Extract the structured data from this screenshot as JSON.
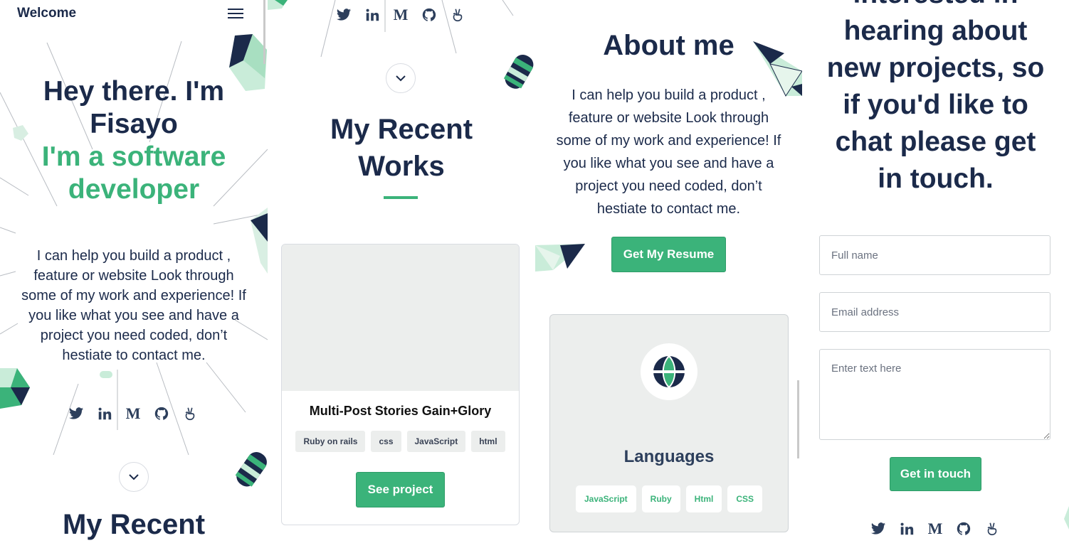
{
  "colors": {
    "navy": "#1b2a4a",
    "green": "#3bb37a",
    "grey_bg": "#eceeed"
  },
  "panel1": {
    "header_title": "Welcome",
    "menu_icon": "hamburger-icon",
    "hero_line1": "Hey there. I'm",
    "hero_line2": "Fisayo",
    "hero_sub_line1": "I'm a software",
    "hero_sub_line2": "developer",
    "intro": "I can help you build a product , feature or website Look through some of my work and experience! If you like what you see and have a project you need coded, don’t hestiate to contact me.",
    "section_peek": "My Recent"
  },
  "socials": {
    "twitter": "twitter-icon",
    "linkedin": "in",
    "medium": "M",
    "github": "github-icon",
    "angellist": "angellist-icon"
  },
  "panel2": {
    "section_title_line1": "My Recent",
    "section_title_line2": "Works",
    "project": {
      "title": "Multi-Post Stories Gain+Glory",
      "tags": [
        "Ruby on rails",
        "css",
        "JavaScript",
        "html"
      ],
      "button": "See project"
    }
  },
  "panel3": {
    "title": "About me",
    "intro": "I can help you build a product , feature or website Look through some of my work and experience! If you like what you see and have a project you need coded, don’t hestiate to contact me.",
    "resume_button": "Get My Resume",
    "skills": {
      "icon": "globe-icon",
      "title": "Languages",
      "tags": [
        "JavaScript",
        "Ruby",
        "Html",
        "CSS"
      ]
    }
  },
  "panel4": {
    "title_lines": [
      "interested in",
      "hearing about",
      "new projects, so",
      "if you'd like to",
      "chat please get",
      "in touch."
    ],
    "form": {
      "name_placeholder": "Full name",
      "email_placeholder": "Email address",
      "message_placeholder": "Enter text here",
      "submit": "Get in touch"
    }
  }
}
